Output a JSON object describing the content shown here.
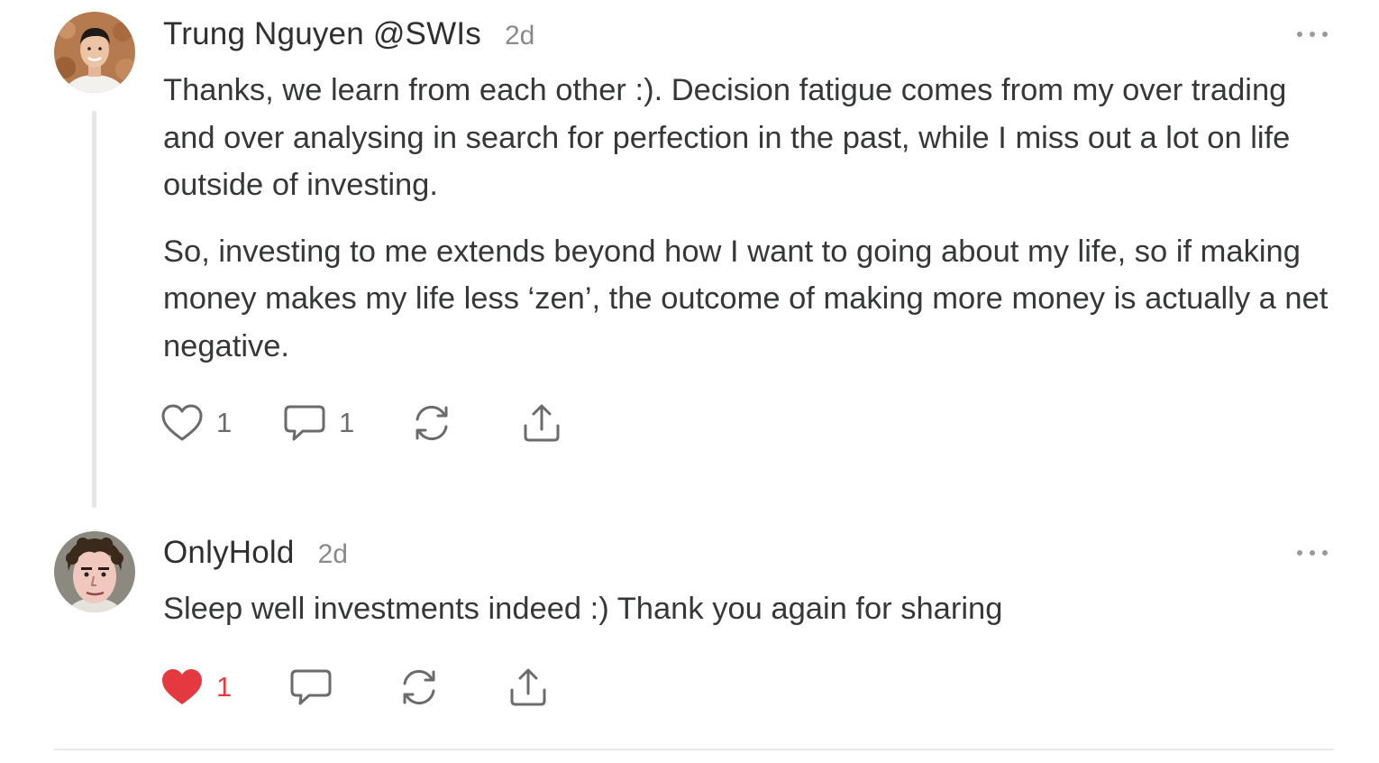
{
  "comments": [
    {
      "author": "Trung Nguyen @SWIs",
      "time": "2d",
      "avatar_icon": "person-photo-avatar",
      "paragraphs": [
        "Thanks, we learn from each other :). Decision fatigue comes from my over trading and over analysing in search for perfection in the past, while I miss out a lot on life outside of investing.",
        "So, investing to me extends beyond how I want to going about my life, so if making money makes my life less ‘zen’, the outcome of making more money is actually a net negative."
      ],
      "likes": "1",
      "liked": false,
      "replies": "1",
      "more_icon": "more-dots-icon"
    },
    {
      "author": "OnlyHold",
      "time": "2d",
      "avatar_icon": "cartoon-face-avatar",
      "paragraphs": [
        "Sleep well investments indeed :) Thank you again for sharing"
      ],
      "likes": "1",
      "liked": true,
      "more_icon": "more-dots-icon"
    }
  ],
  "colors": {
    "text": "#363737",
    "muted": "#8a8a8a",
    "like_active": "#e43a3f",
    "icon": "#6b6b6b",
    "thread_line": "#e6e6e6"
  }
}
